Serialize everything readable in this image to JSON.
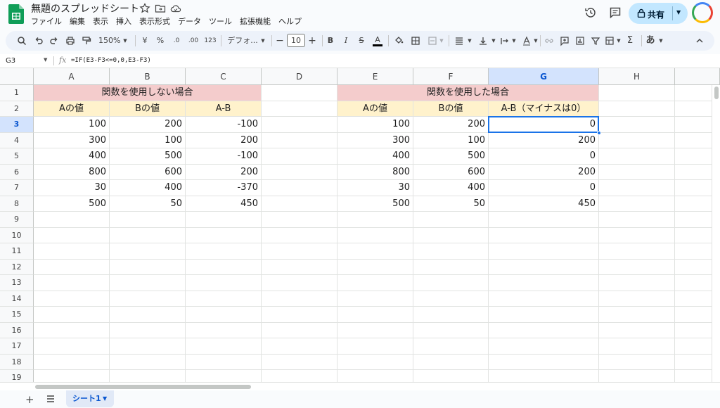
{
  "app": {
    "title": "無題のスプレッドシート",
    "brand_color": "#0f9d58"
  },
  "menu": [
    "ファイル",
    "編集",
    "表示",
    "挿入",
    "表示形式",
    "データ",
    "ツール",
    "拡張機能",
    "ヘルプ"
  ],
  "header": {
    "share_label": "共有"
  },
  "toolbar": {
    "zoom": "150%",
    "currency": "¥",
    "percent": "%",
    "dec_minus": ".0",
    "dec_plus": ".00",
    "number_format": "123",
    "font": "デフォ...",
    "font_size": "10",
    "bold": "B",
    "italic": "I",
    "text_color": "A",
    "sigma": "Σ",
    "input_mode": "あ"
  },
  "formula_bar": {
    "cell_ref": "G3",
    "fx": "fx",
    "formula": "=IF(E3-F3<=0,0,E3-F3)"
  },
  "grid": {
    "columns": [
      "A",
      "B",
      "C",
      "D",
      "E",
      "F",
      "G",
      "H"
    ],
    "selected_column": "G",
    "rows": [
      "1",
      "2",
      "3",
      "4",
      "5",
      "6",
      "7",
      "8",
      "9",
      "10",
      "11",
      "12",
      "13",
      "14",
      "15",
      "16",
      "17",
      "18",
      "19"
    ],
    "selected_row": "3",
    "left_table": {
      "title": "関数を使用しない場合",
      "headers": [
        "Aの値",
        "Bの値",
        "A-B"
      ],
      "rows": [
        [
          "100",
          "200",
          "-100"
        ],
        [
          "300",
          "100",
          "200"
        ],
        [
          "400",
          "500",
          "-100"
        ],
        [
          "800",
          "600",
          "200"
        ],
        [
          "30",
          "400",
          "-370"
        ],
        [
          "500",
          "50",
          "450"
        ]
      ]
    },
    "right_table": {
      "title": "関数を使用した場合",
      "headers": [
        "Aの値",
        "Bの値",
        "A-B（マイナスは0）"
      ],
      "rows": [
        [
          "100",
          "200",
          "0"
        ],
        [
          "300",
          "100",
          "200"
        ],
        [
          "400",
          "500",
          "0"
        ],
        [
          "800",
          "600",
          "200"
        ],
        [
          "30",
          "400",
          "0"
        ],
        [
          "500",
          "50",
          "450"
        ]
      ]
    }
  },
  "sheets": {
    "active": "シート1"
  }
}
